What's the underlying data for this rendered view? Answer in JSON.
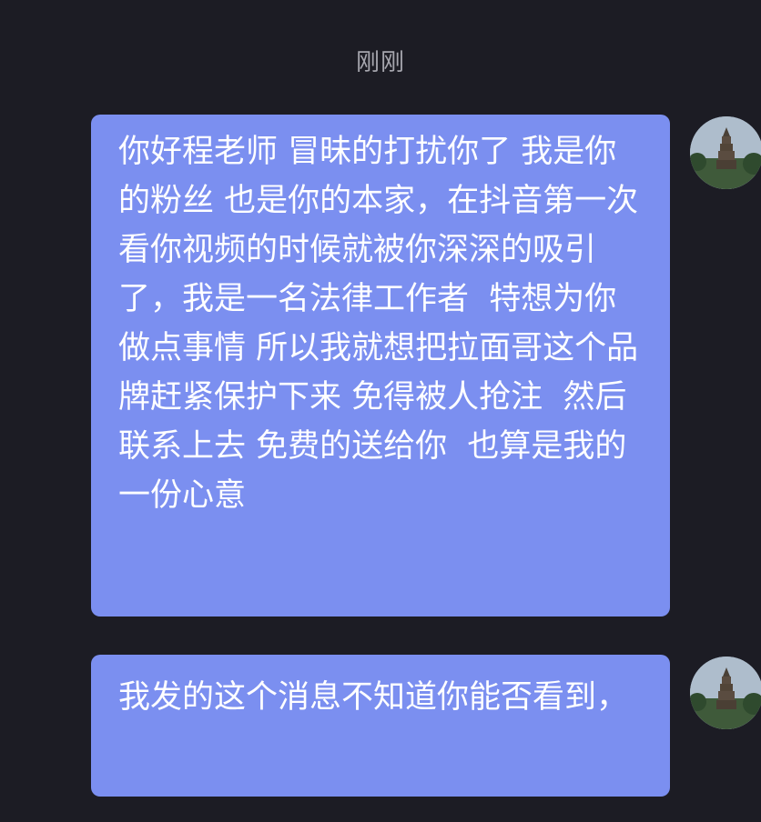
{
  "chat": {
    "timestamp": "刚刚",
    "messages": [
      {
        "text": "你好程老师 冒昧的打扰你了 我是你的粉丝 也是你的本家，在抖音第一次看你视频的时候就被你深深的吸引了，我是一名法律工作者  特想为你做点事情 所以我就想把拉面哥这个品牌赶紧保护下来 免得被人抢注  然后联系上去 免费的送给你  也算是我的一份心意",
        "avatar": "pagoda-avatar"
      },
      {
        "text": "我发的这个消息不知道你能否看到，",
        "avatar": "pagoda-avatar"
      }
    ]
  },
  "colors": {
    "background": "#1c1c24",
    "bubble": "#7b8ff0",
    "timestamp": "#a6a6ae",
    "text": "#ffffff"
  }
}
